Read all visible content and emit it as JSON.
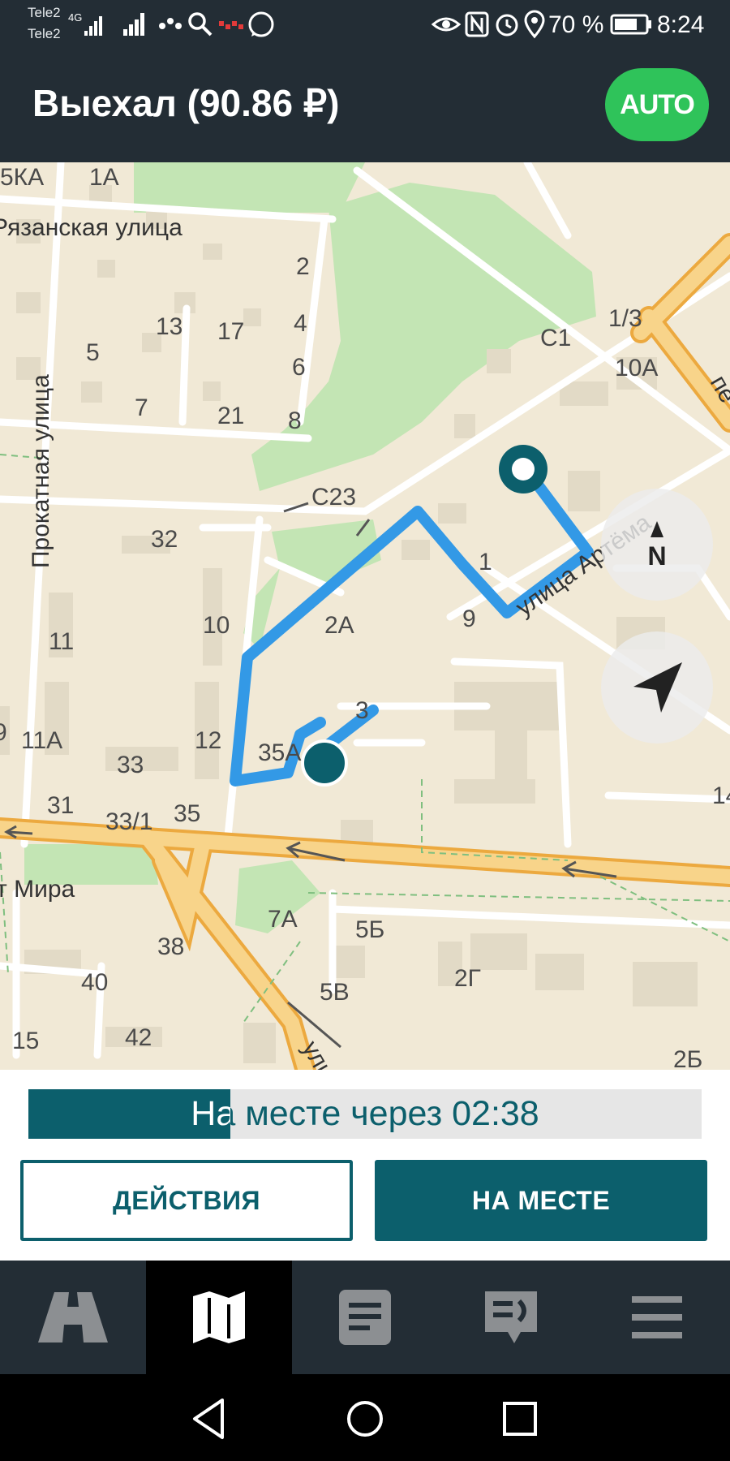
{
  "status_bar": {
    "carrier_1": "Tele2",
    "carrier_2": "Tele2",
    "network": "4G",
    "battery": "70 %",
    "time": "8:24"
  },
  "app_bar": {
    "title": "Выехал (90.86 ₽)",
    "auto_label": "AUTO"
  },
  "map": {
    "street_labels": {
      "ryazanskaya": "Рязанская улица",
      "prokatnaya": "Прокатная улица",
      "artema": "улица Артёма",
      "mira": "т Мира",
      "uli": "ули",
      "per": "пе"
    },
    "house_numbers": [
      "5КА",
      "1А",
      "2",
      "13",
      "17",
      "4",
      "5",
      "6",
      "7",
      "21",
      "8",
      "С1",
      "1/3",
      "10А",
      "С23",
      "32",
      "1",
      "9",
      "10",
      "2А",
      "11",
      "3",
      "9",
      "11А",
      "12",
      "35А",
      "33",
      "31",
      "35",
      "33/1",
      "7А",
      "5Б",
      "38",
      "2Г",
      "40",
      "5В",
      "15",
      "42",
      "14",
      "2Б"
    ],
    "compass_label": "N",
    "colors": {
      "route": "#3399e6",
      "marker": "#0c5f6c",
      "major_road": "#f5c46a",
      "park": "#c3e5b4"
    }
  },
  "eta": {
    "text": "На месте через 02:38",
    "progress": 0.3
  },
  "buttons": {
    "actions": "ДЕЙСТВИЯ",
    "arrived": "НА МЕСТЕ"
  },
  "nav": {
    "items": [
      "road-icon",
      "map-icon",
      "orders-icon",
      "chat-icon",
      "menu-icon"
    ],
    "active": "map-icon"
  }
}
